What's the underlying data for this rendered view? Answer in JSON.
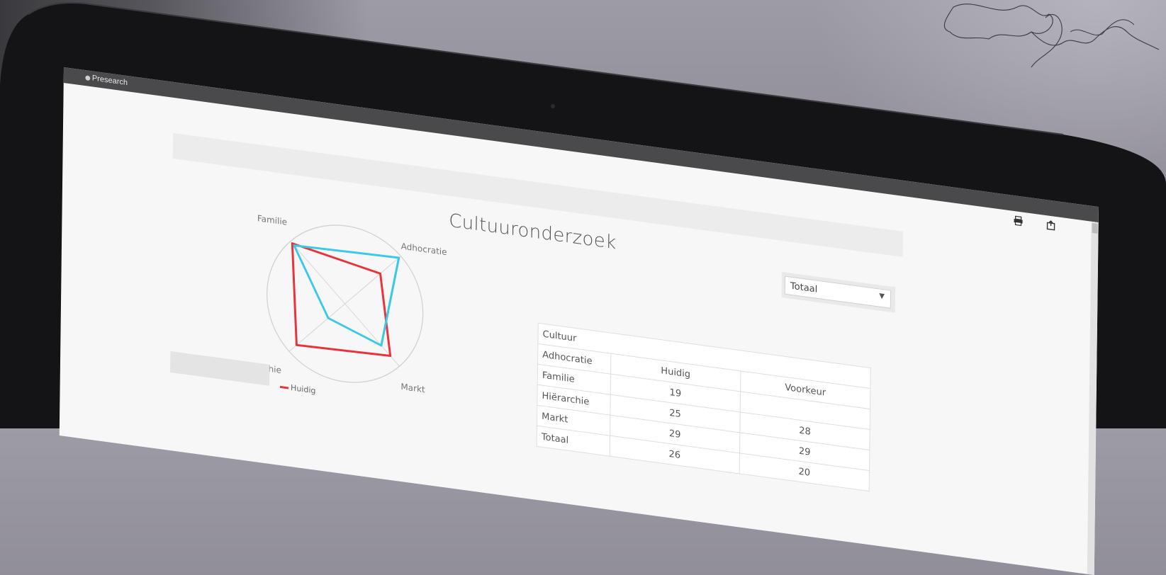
{
  "app": {
    "title": "Presearch"
  },
  "page": {
    "title": "Cultuuronderzoek"
  },
  "filter": {
    "selected": "Totaal"
  },
  "chart_data": {
    "type": "radar",
    "axes": [
      "Familie",
      "Adhocratie",
      "Markt",
      "Hiërarchie"
    ],
    "series": [
      {
        "name": "Huidig",
        "color": "#e8333a",
        "values": [
          29,
          19,
          25,
          26
        ]
      },
      {
        "name": "Voorkeur",
        "color": "#3cc8e8",
        "values": [
          28,
          29,
          20,
          9
        ]
      }
    ],
    "range": [
      0,
      30
    ],
    "legend": [
      "Huidig"
    ]
  },
  "table": {
    "title": "Cultuur",
    "headers": [
      "",
      "Huidig",
      "Voorkeur"
    ],
    "rows": [
      {
        "label": "Adhocratie",
        "huidig": "19",
        "voorkeur": "28"
      },
      {
        "label": "Familie",
        "huidig": "25",
        "voorkeur": "29"
      },
      {
        "label": "Hiërarchie",
        "huidig": "29",
        "voorkeur": "20"
      },
      {
        "label": "Markt",
        "huidig": "26",
        "voorkeur": ""
      },
      {
        "label": "Totaal",
        "huidig": "",
        "voorkeur": ""
      }
    ]
  },
  "icons": {
    "print": "print-icon",
    "export": "export-icon"
  }
}
